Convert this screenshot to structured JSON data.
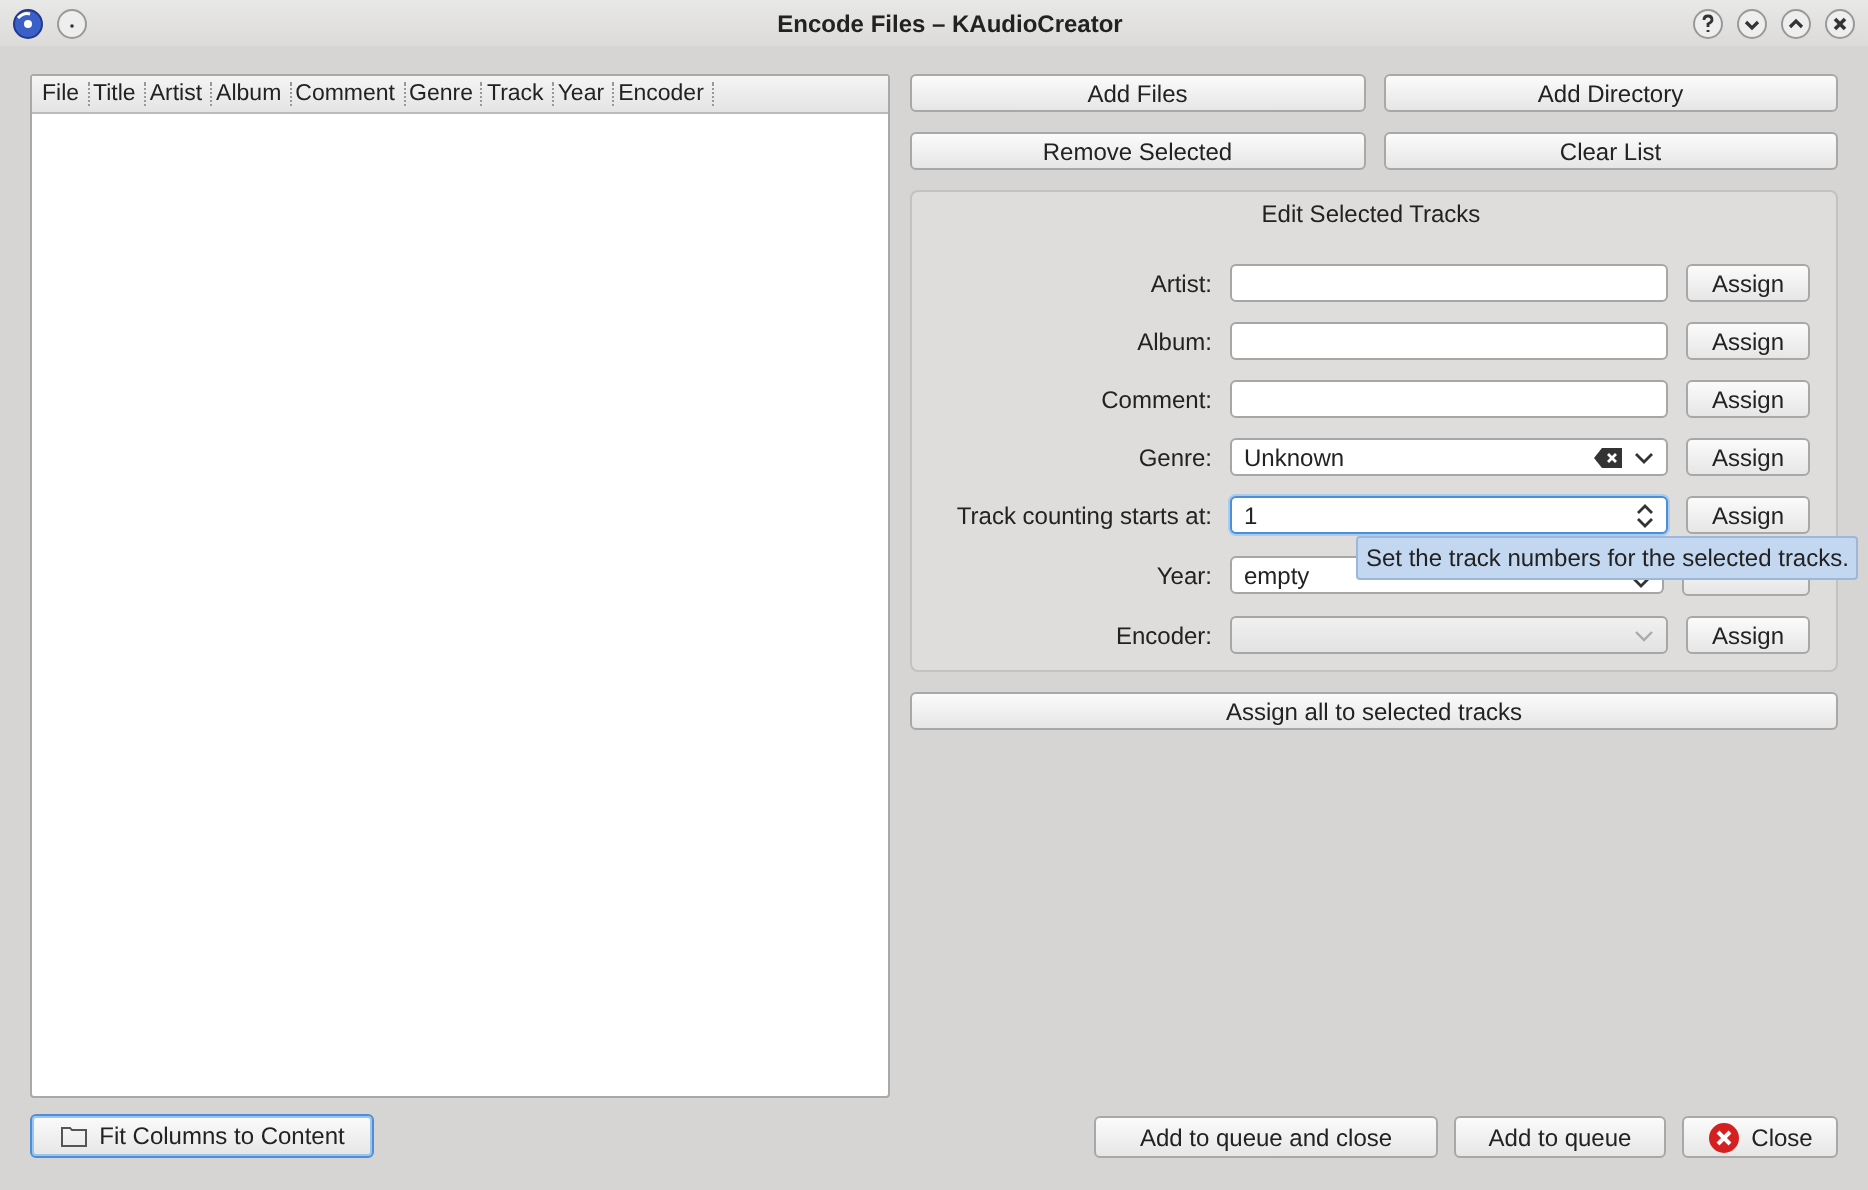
{
  "window": {
    "title": "Encode Files – KAudioCreator"
  },
  "file_list": {
    "columns": [
      "File",
      "Title",
      "Artist",
      "Album",
      "Comment",
      "Genre",
      "Track",
      "Year",
      "Encoder"
    ]
  },
  "top_buttons": [
    "Add Files",
    "Add Directory",
    "Remove Selected",
    "Clear List"
  ],
  "edit_group": {
    "title": "Edit Selected Tracks",
    "rows": [
      {
        "label": "Artist:",
        "kind": "text",
        "value": "",
        "focused": false,
        "disabled": false,
        "button": "Assign"
      },
      {
        "label": "Album:",
        "kind": "text",
        "value": "",
        "focused": false,
        "disabled": false,
        "button": "Assign"
      },
      {
        "label": "Comment:",
        "kind": "text",
        "value": "",
        "focused": false,
        "disabled": false,
        "button": "Assign"
      },
      {
        "label": "Genre:",
        "kind": "combo-clear",
        "value": "Unknown",
        "focused": false,
        "disabled": false,
        "button": "Assign"
      },
      {
        "label": "Track counting starts at:",
        "kind": "spin",
        "value": "1",
        "focused": true,
        "disabled": false,
        "button": "Assign"
      },
      {
        "label": "Year:",
        "kind": "spin",
        "value": "empty",
        "focused": false,
        "disabled": false
      },
      {
        "label": "Encoder:",
        "kind": "combo",
        "value": "",
        "focused": false,
        "disabled": true,
        "button": "Assign"
      }
    ]
  },
  "assign_all_button": "Assign all to selected tracks",
  "tooltip": "Set the track numbers for the selected tracks.",
  "fit_button": "Fit Columns to Content",
  "bottom_buttons": [
    {
      "label": "Add to queue and close",
      "kind": "plain"
    },
    {
      "label": "Add to queue",
      "kind": "plain"
    },
    {
      "label": "Close",
      "kind": "close"
    }
  ]
}
